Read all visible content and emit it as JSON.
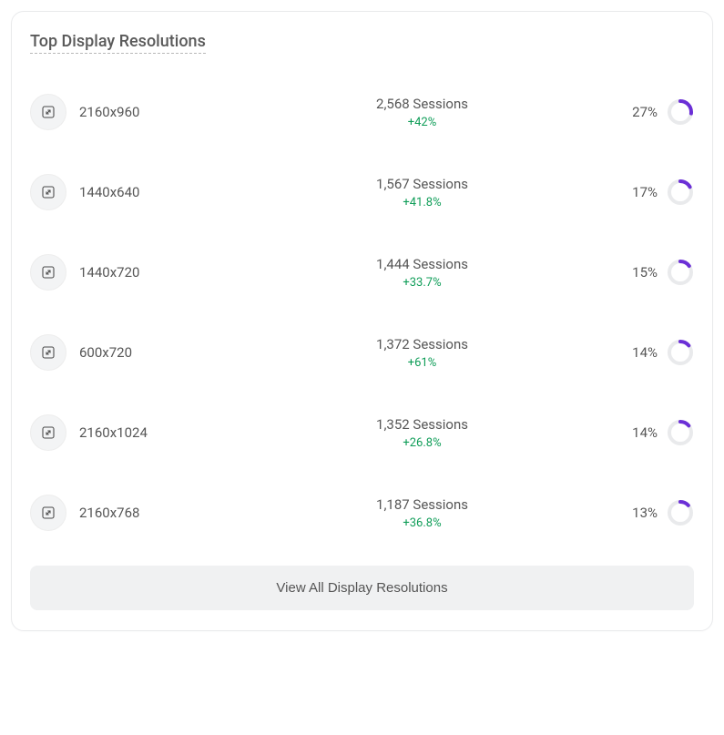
{
  "title": "Top Display Resolutions",
  "footer_label": "View All Display Resolutions",
  "chart_data": {
    "type": "table",
    "title": "Top Display Resolutions",
    "columns": [
      "resolution",
      "sessions_label",
      "delta_label",
      "share_pct"
    ],
    "rows": [
      {
        "resolution": "2160x960",
        "sessions_label": "2,568 Sessions",
        "delta_label": "+42%",
        "share_pct": 27,
        "share_label": "27%"
      },
      {
        "resolution": "1440x640",
        "sessions_label": "1,567 Sessions",
        "delta_label": "+41.8%",
        "share_pct": 17,
        "share_label": "17%"
      },
      {
        "resolution": "1440x720",
        "sessions_label": "1,444 Sessions",
        "delta_label": "+33.7%",
        "share_pct": 15,
        "share_label": "15%"
      },
      {
        "resolution": "600x720",
        "sessions_label": "1,372 Sessions",
        "delta_label": "+61%",
        "share_pct": 14,
        "share_label": "14%"
      },
      {
        "resolution": "2160x1024",
        "sessions_label": "1,352 Sessions",
        "delta_label": "+26.8%",
        "share_pct": 14,
        "share_label": "14%"
      },
      {
        "resolution": "2160x768",
        "sessions_label": "1,187 Sessions",
        "delta_label": "+36.8%",
        "share_pct": 13,
        "share_label": "13%"
      }
    ]
  }
}
